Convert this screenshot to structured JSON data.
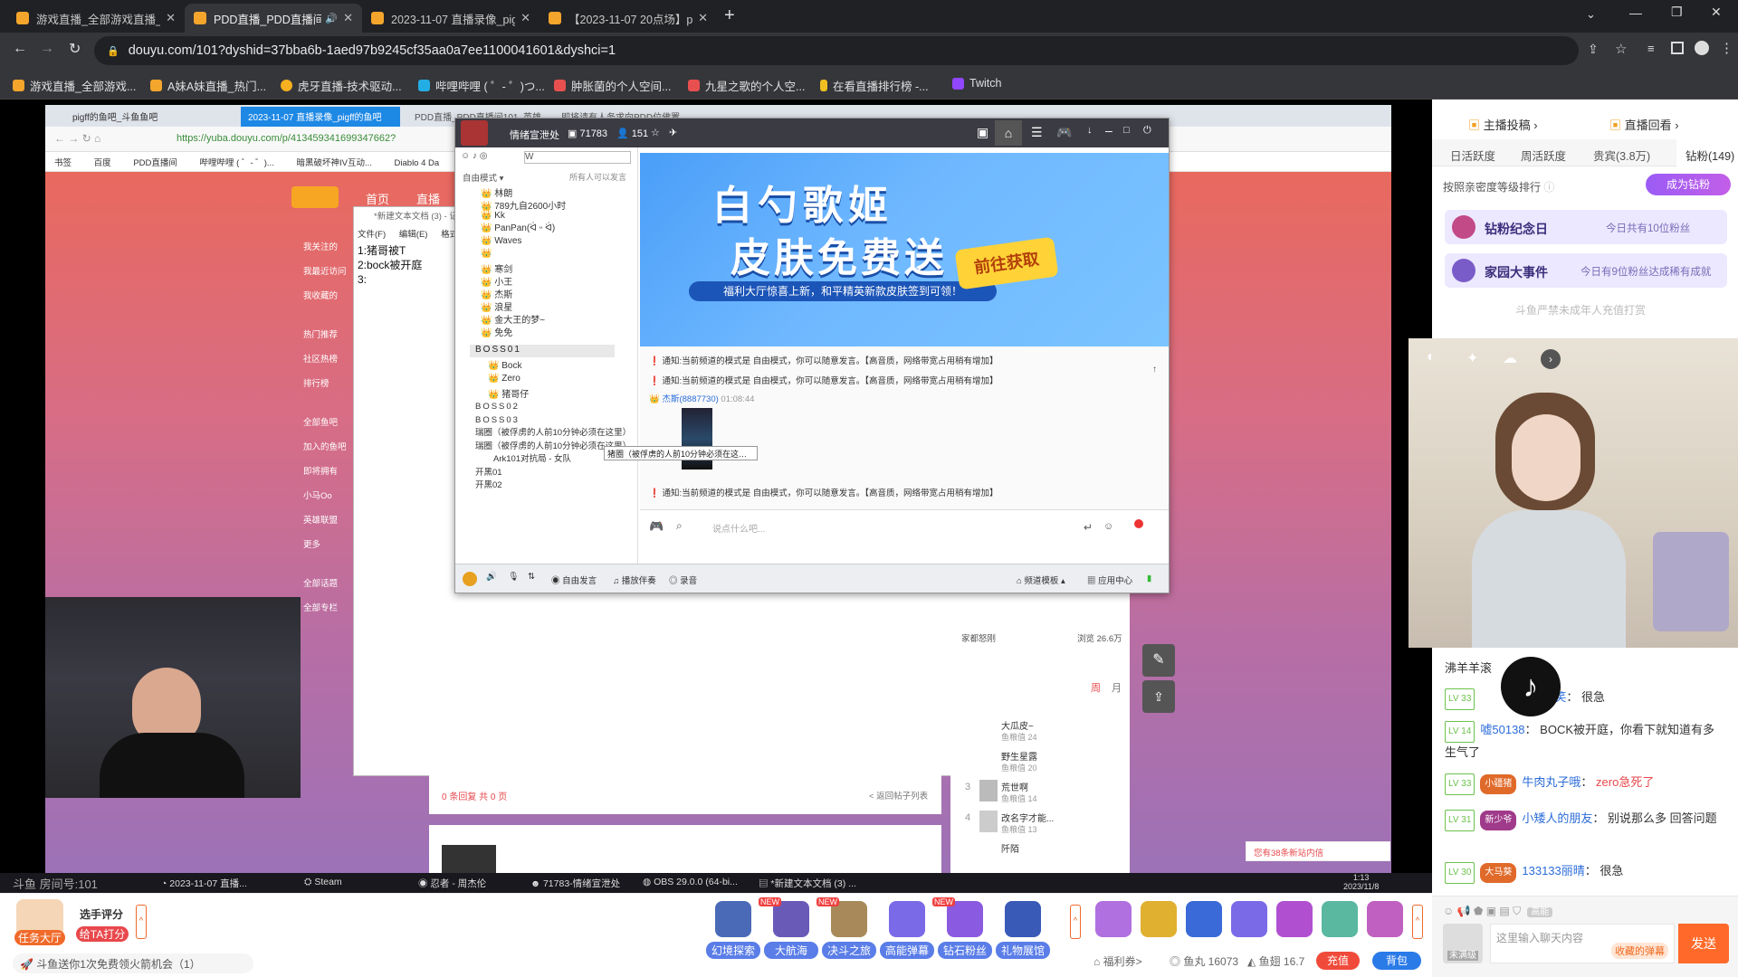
{
  "browser": {
    "tabs": [
      {
        "title": "游戏直播_全部游戏直播_斗鱼直"
      },
      {
        "title": "PDD直播_PDD直播间101_"
      },
      {
        "title": "2023-11-07 直播录像_pigff的"
      },
      {
        "title": "【2023-11-07 20点场】pigff:"
      }
    ],
    "url": "douyu.com/101?dyshid=37bba6b-1aed97b9245cf35aa0a7ee1100041601&dyshci=1",
    "bookmarks": [
      "游戏直播_全部游戏...",
      "A妹A妹直播_热门...",
      "虎牙直播-技术驱动...",
      "哔哩哔哩 ( ゜- ゜)つ...",
      "肿胀菌的个人空间...",
      "九星之歌的个人空...",
      "在看直播排行榜 -...",
      "Twitch"
    ]
  },
  "stream": {
    "inner_browser": {
      "tabs": [
        "pigff的鱼吧_斗鱼鱼吧",
        "2023-11-07 直播录像_pigff的鱼吧",
        "PDD直播_PDD直播间101_英雄联盟...",
        "即将请有人务求向PDD位佛置..."
      ],
      "url": "https://yuba.douyu.com/p/413459341699347662?",
      "bookmarks": [
        "书签",
        "百度",
        "PDD直播间",
        "哔哩哔哩 ( ゜- ゜)...",
        "暗黑破坏神IV互动...",
        "Diablo 4 Da"
      ]
    },
    "page": {
      "nav": [
        "首页",
        "直播"
      ],
      "sidebar": [
        "我关注的",
        "我最近访问",
        "我收藏的",
        "热门推荐",
        "社区热榜",
        "排行榜",
        "全部鱼吧",
        "加入的鱼吧",
        "即将拥有",
        "小马Oo",
        "英雄联盟",
        "更多",
        "全部话题",
        "全部专栏"
      ],
      "reply_count": "0 条回复 共 0 页",
      "back_link": "< 返回帖子列表",
      "hot_tab_week": "周",
      "hot_tab_month": "月",
      "hot_items": [
        {
          "rank": "",
          "name": "大瓜皮~",
          "sub": "鱼粮值 24"
        },
        {
          "rank": "",
          "name": "野生星露",
          "sub": "鱼粮值 20"
        },
        {
          "rank": "3",
          "name": "荒世啊",
          "sub": "鱼粮值 14"
        },
        {
          "rank": "4",
          "name": "改名字才能...",
          "sub": "鱼粮值 13"
        },
        {
          "rank": "",
          "name": "阡陌",
          "sub": ""
        }
      ],
      "stat1": "家都怒刚",
      "stat2": "浏览 26.6万",
      "new_msg": "您有38条新站内信"
    },
    "notepad": {
      "title": "*新建文本文档 (3) - 记事本",
      "menu": [
        "文件(F)",
        "编辑(E)",
        "格式(O)"
      ],
      "lines": [
        "1:猪哥被T",
        "2:bock被开庭",
        "3:"
      ]
    },
    "yy": {
      "channel_title": "情绪宣泄处",
      "channel_id": "71783",
      "online": "151",
      "mode": "自由模式",
      "mode_right": "所有人可以发言",
      "search": "W",
      "members": [
        {
          "name": "林朗",
          "indent": 1
        },
        {
          "name": "789九自2600小时",
          "indent": 1
        },
        {
          "name": "Kk",
          "indent": 1
        },
        {
          "name": "PanPan(ᐛ ᵕ ᐛ)",
          "indent": 1
        },
        {
          "name": "Waves",
          "indent": 1
        },
        {
          "name": "",
          "indent": 1
        },
        {
          "name": "寒剑",
          "indent": 1
        },
        {
          "name": "小王",
          "indent": 1
        },
        {
          "name": "杰斯",
          "indent": 1
        },
        {
          "name": "浪星",
          "indent": 1
        },
        {
          "name": "金大王的梦~",
          "indent": 1
        },
        {
          "name": "免免",
          "indent": 1
        }
      ],
      "boss1": "BOSS01",
      "boss1_members": [
        "Bock",
        "Zero",
        "猪哥仔"
      ],
      "channels_after": [
        "BOSS02",
        "BOSS03",
        "瑞圈（被俘虏的人前10分钟必须在这里）",
        "瑞圈（被俘虏的人前10分钟必须在这里）",
        "Ark101对抗局 - 女队",
        "开黑01",
        "开黑02"
      ],
      "tooltip": "猪圈（被俘虏的人前10分钟必须在这里）",
      "banner_title_1": "白勺歌姬",
      "banner_title_2": "皮肤免费送",
      "banner_sub": "福利大厅惊喜上新，和平精英新款皮肤签到可领！",
      "banner_btn": "前往获取",
      "notice_label": "通知:",
      "notice_text": "当前频道的模式是 自由模式，你可以随意发言。【高音质，网络带宽占用稍有增加】",
      "chat_user": "杰斯(8887730)",
      "chat_time": "01:08:44",
      "input_placeholder": "说点什么吧...",
      "bottom": [
        "自由发言",
        "播放伴奏",
        "录音",
        "频道模板",
        "应用中心"
      ]
    },
    "taskbar": {
      "items": [
        "斗鱼 房间号:101",
        "2023-11-07 直播...",
        "Steam",
        "忍者 - 周杰伦",
        "71783-情绪宣泄处",
        "OBS 29.0.0 (64-bi...",
        "*新建文本文档 (3) ..."
      ],
      "clock_time": "1:13",
      "clock_date": "2023/11/8"
    }
  },
  "right_panel": {
    "top_links": [
      "主播投稿",
      "直播回看"
    ],
    "rank_tabs": [
      "日活跃度",
      "周活跃度",
      "贵宾(3.8万)",
      "钻粉(149)"
    ],
    "sort_hint": "按照亲密度等级排行",
    "become_fan": "成为钻粉",
    "anniversary": "钻粉纪念日",
    "anniversary_right": "今日共有10位粉丝",
    "family_event": "家园大事件",
    "family_right": "今日有9位粉丝达成稀有成就",
    "notice": "斗鱼严禁未成年人充值打赏",
    "chat": [
      {
        "level": "",
        "user": "",
        "text": "沸羊羊滚"
      },
      {
        "level": "LV 33",
        "user": "天渡笑",
        "text": "很急"
      },
      {
        "level": "LV 14",
        "user": "嘘50138",
        "text": "BOCK被开庭，你看下就知道有多生气了"
      },
      {
        "level": "LV 33",
        "user": "牛肉丸子哦",
        "text": "zero急死了"
      },
      {
        "level": "LV 31",
        "user": "小矮人的朋友",
        "text": "别说那么多 回答问题"
      },
      {
        "level": "LV 30",
        "user": "133133丽晴",
        "text": "很急"
      }
    ],
    "chat_badges": [
      "小疆猪",
      "新少爷",
      "大马葵"
    ],
    "input_placeholder": "这里输入聊天内容",
    "send": "发送",
    "barrage_btn": "收藏的弹幕",
    "not_full": "未满级",
    "hd_label": "高能"
  },
  "bottom_bar": {
    "left": [
      "任务大厅",
      "选手评分",
      "给TA打分"
    ],
    "promo": "斗鱼送你1次免费领火箭机会（1）",
    "gifts": [
      "幻境探索",
      "大航海",
      "决斗之旅",
      "高能弹幕",
      "钻石粉丝",
      "礼物展馆"
    ],
    "new_badge": "NEW",
    "welfare": "福利券>",
    "fish_ball": "鱼丸 16073",
    "fish_wing": "鱼翅 16.7",
    "recharge": "充值",
    "backpack": "背包"
  }
}
